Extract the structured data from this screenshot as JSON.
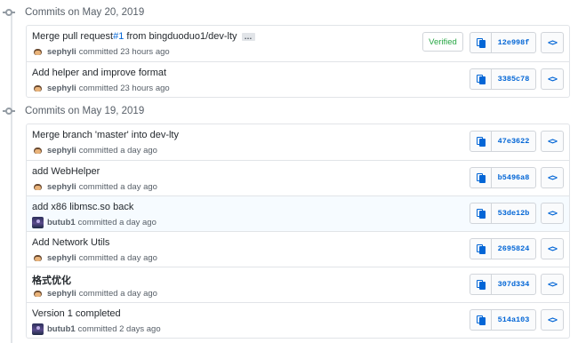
{
  "groups": [
    {
      "title": "Commits on May 20, 2019",
      "commits": [
        {
          "message_prefix": "Merge pull request ",
          "issue": "#1",
          "message_suffix": " from bingduoduo1/dev-lty",
          "has_ellipsis": true,
          "author": "sephyli",
          "action": "committed 23 hours ago",
          "avatar": "cat",
          "verified": "Verified",
          "sha": "12e998f"
        },
        {
          "message": "Add helper and improve format",
          "author": "sephyli",
          "action": "committed 23 hours ago",
          "avatar": "cat",
          "sha": "3385c78"
        }
      ]
    },
    {
      "title": "Commits on May 19, 2019",
      "commits": [
        {
          "message": "Merge branch 'master' into dev-lty",
          "author": "sephyli",
          "action": "committed a day ago",
          "avatar": "cat",
          "sha": "47e3622"
        },
        {
          "message": "add WebHelper",
          "author": "sephyli",
          "action": "committed a day ago",
          "avatar": "cat",
          "sha": "b5496a8"
        },
        {
          "message": "add x86 libmsc.so back",
          "author": "butub1",
          "action": "committed a day ago",
          "avatar": "photo",
          "sha": "53de12b",
          "highlight": true
        },
        {
          "message": "Add Network Utils",
          "author": "sephyli",
          "action": "committed a day ago",
          "avatar": "cat",
          "sha": "2695824"
        },
        {
          "message": "格式优化",
          "author": "sephyli",
          "action": "committed a day ago",
          "avatar": "cat",
          "sha": "307d334"
        },
        {
          "message": "Version 1 completed",
          "author": "butub1",
          "action": "committed 2 days ago",
          "avatar": "photo",
          "sha": "514a103"
        }
      ]
    }
  ],
  "ellipsis_label": "…",
  "browse_label": "<>",
  "icons": {
    "timeline": "commit-dot-icon",
    "copy": "clipboard-icon",
    "browse": "code-icon"
  },
  "colors": {
    "link": "#0366d6",
    "verified": "#28a745",
    "border": "#e1e4e8",
    "muted": "#586069"
  }
}
